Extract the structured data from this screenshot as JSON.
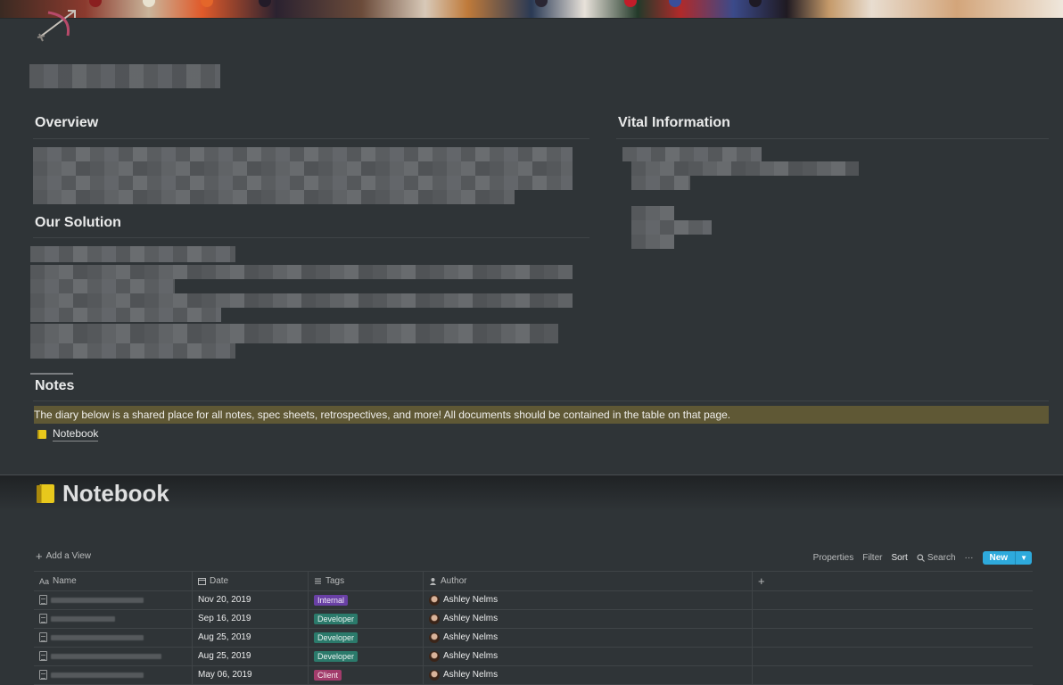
{
  "sections": {
    "overview": "Overview",
    "vital_information": "Vital Information",
    "our_solution": "Our Solution",
    "notes": "Notes"
  },
  "notes_callout": "The diary below is a shared place for all notes, spec sheets, retrospectives, and more! All documents should be contained in the table on that page.",
  "notebook_link": {
    "icon": "notebook-icon",
    "label": "Notebook"
  },
  "notebook": {
    "title": "Notebook",
    "add_view": "Add a View",
    "toolbar": {
      "properties": "Properties",
      "filter": "Filter",
      "sort": "Sort",
      "search": "Search",
      "more": "···",
      "new": "New"
    },
    "columns": [
      "Name",
      "Date",
      "Tags",
      "Author"
    ],
    "add_column": "+",
    "rows": [
      {
        "date": "Nov 20, 2019",
        "tag": "Internal",
        "tag_color": "#6940a5",
        "author": "Ashley Nelms"
      },
      {
        "date": "Sep 16, 2019",
        "tag": "Developer",
        "tag_color": "#2b7a6b",
        "author": "Ashley Nelms"
      },
      {
        "date": "Aug 25, 2019",
        "tag": "Developer",
        "tag_color": "#2b7a6b",
        "author": "Ashley Nelms"
      },
      {
        "date": "Aug 25, 2019",
        "tag": "Developer",
        "tag_color": "#2b7a6b",
        "author": "Ashley Nelms"
      },
      {
        "date": "May 06, 2019",
        "tag": "Client",
        "tag_color": "#a23c6b",
        "author": "Ashley Nelms"
      }
    ]
  },
  "colors": {
    "background": "#2f3437",
    "accent": "#2eaadc",
    "callout": "#5f5835"
  }
}
